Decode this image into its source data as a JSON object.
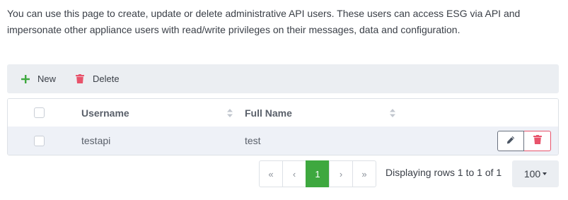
{
  "description": "You can use this page to create, update or delete administrative API users. These users can access ESG via API and impersonate other appliance users with read/write privileges on their messages, data and configuration.",
  "toolbar": {
    "new_label": "New",
    "delete_label": "Delete",
    "new_icon": "plus-icon",
    "delete_icon": "trash-icon"
  },
  "table": {
    "columns": [
      "Username",
      "Full Name"
    ],
    "rows": [
      {
        "username": "testapi",
        "full_name": "test"
      }
    ]
  },
  "pagination": {
    "first": "«",
    "prev": "‹",
    "current_page": "1",
    "next": "›",
    "last": "»",
    "info": "Displaying rows 1 to 1 of 1",
    "page_size": "100"
  },
  "colors": {
    "accent_green": "#3ea83f",
    "danger_red": "#e8536b",
    "toolbar_bg": "#ebeef2",
    "row_bg": "#eef1f7"
  }
}
